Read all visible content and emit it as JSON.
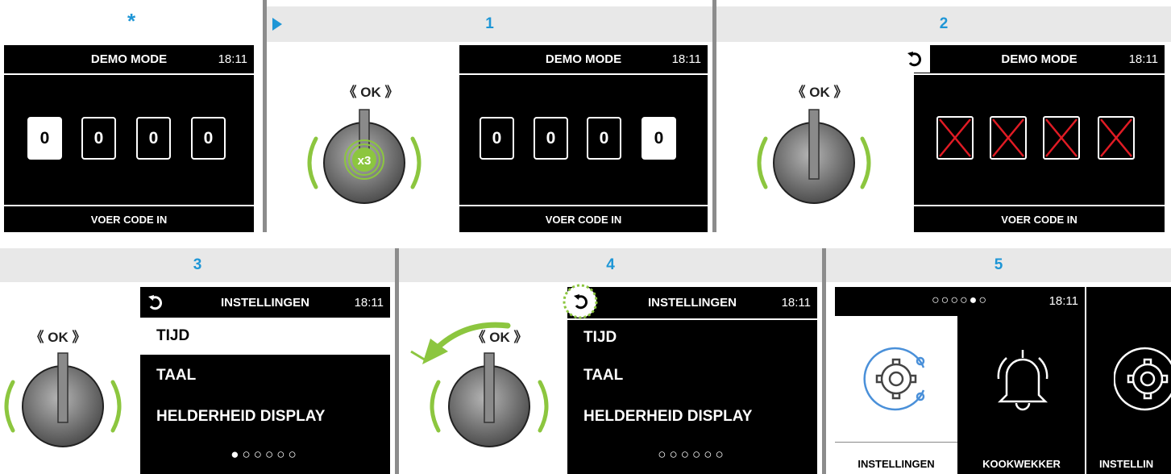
{
  "panels": {
    "star": {
      "label": "*"
    },
    "p1": {
      "label": "1"
    },
    "p2": {
      "label": "2"
    },
    "p3": {
      "label": "3"
    },
    "p4": {
      "label": "4"
    },
    "p5": {
      "label": "5"
    }
  },
  "ok_label": "《 OK 》",
  "knob_press": "x3",
  "screen_code": {
    "title": "DEMO MODE",
    "time": "18:11",
    "footer": "VOER CODE IN",
    "digits": [
      "0",
      "0",
      "0",
      "0"
    ]
  },
  "screen_settings": {
    "title": "INSTELLINGEN",
    "time": "18:11",
    "items": [
      "TIJD",
      "TAAL",
      "HELDERHEID DISPLAY"
    ],
    "dots_active": "●○○○○○",
    "dots_inactive": "○○○○○○"
  },
  "screen_menu": {
    "dots": "○○○○●○",
    "time": "18:11",
    "tiles": [
      "INSTELLINGEN",
      "KOOKWEKKER",
      "INSTELLIN"
    ]
  },
  "colors": {
    "accent": "#1e96d6",
    "green": "#8cc63f",
    "red": "#e01b24",
    "icon_blue": "#4a90d9"
  }
}
